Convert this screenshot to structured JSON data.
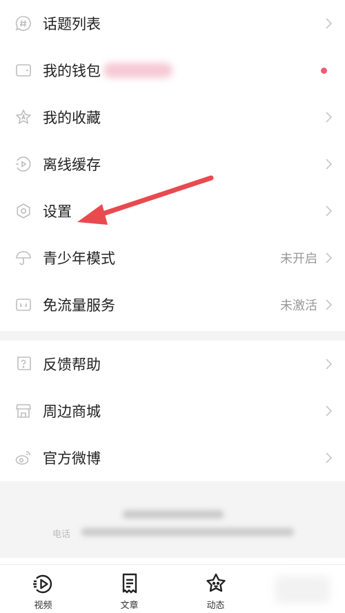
{
  "menu_group_1": [
    {
      "label": "话题列表",
      "icon": "hash-bubble-icon",
      "value": "",
      "dot": false
    },
    {
      "label": "我的钱包",
      "icon": "wallet-icon",
      "value": "",
      "dot": true
    },
    {
      "label": "我的收藏",
      "icon": "star-a-icon",
      "value": "",
      "dot": false
    },
    {
      "label": "离线缓存",
      "icon": "offline-play-icon",
      "value": "",
      "dot": false
    },
    {
      "label": "设置",
      "icon": "settings-hexagon-icon",
      "value": "",
      "dot": false
    },
    {
      "label": "青少年模式",
      "icon": "umbrella-icon",
      "value": "未开启",
      "dot": false
    },
    {
      "label": "免流量服务",
      "icon": "data-card-icon",
      "value": "未激活",
      "dot": false
    }
  ],
  "menu_group_2": [
    {
      "label": "反馈帮助",
      "icon": "help-question-icon",
      "value": "",
      "dot": false
    },
    {
      "label": "周边商城",
      "icon": "store-icon",
      "value": "",
      "dot": false
    },
    {
      "label": "官方微博",
      "icon": "weibo-icon",
      "value": "",
      "dot": false
    }
  ],
  "footer": {
    "phone_label": "电话"
  },
  "tabs": [
    {
      "label": "视频",
      "icon": "video-play-icon"
    },
    {
      "label": "文章",
      "icon": "article-doc-icon"
    },
    {
      "label": "动态",
      "icon": "dynamic-star-icon"
    }
  ],
  "colors": {
    "accent_red": "#e84a4f",
    "dot_red": "#f05a74",
    "icon_gray": "#bdbdbd",
    "text_gray": "#999999"
  }
}
